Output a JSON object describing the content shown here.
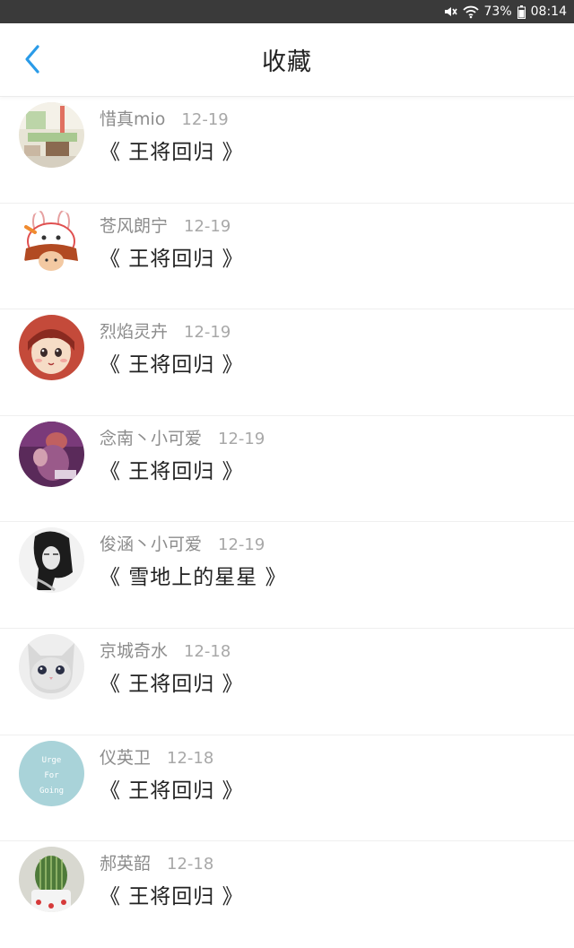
{
  "status_bar": {
    "battery": "73%",
    "time": "08:14"
  },
  "header": {
    "title": "收藏"
  },
  "items": [
    {
      "name": "惜真mio",
      "date": "12-19",
      "title": "《 王将回归 》",
      "avatar": "room-photo"
    },
    {
      "name": "苍风朗宁",
      "date": "12-19",
      "title": "《 王将回归 》",
      "avatar": "bunny-girl-cartoon"
    },
    {
      "name": "烈焰灵卉",
      "date": "12-19",
      "title": "《 王将回归 》",
      "avatar": "anime-girl"
    },
    {
      "name": "念南丶小可爱",
      "date": "12-19",
      "title": "《 王将回归 》",
      "avatar": "purple-photo"
    },
    {
      "name": "俊涵丶小可爱",
      "date": "12-19",
      "title": "《 雪地上的星星 》",
      "avatar": "bw-portrait"
    },
    {
      "name": "京城奇水",
      "date": "12-18",
      "title": "《 王将回归 》",
      "avatar": "white-cat"
    },
    {
      "name": "仪英卫",
      "date": "12-18",
      "title": "《 王将回归 》",
      "avatar": "urge-for-going",
      "avatar_text": [
        "Urge",
        "For",
        "Going"
      ]
    },
    {
      "name": "郝英韶",
      "date": "12-18",
      "title": "《 王将回归 》",
      "avatar": "cactus"
    }
  ]
}
